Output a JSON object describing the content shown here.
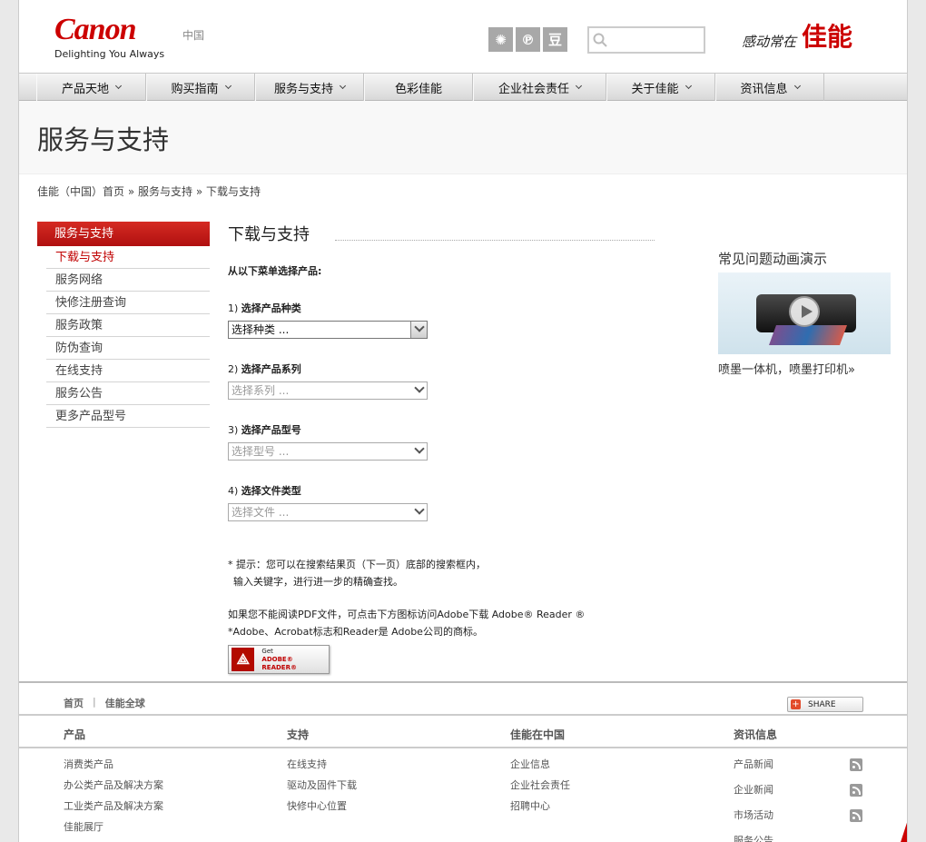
{
  "header": {
    "logo_text": "Canon",
    "tagline": "Delighting You Always",
    "region": "中国",
    "social": [
      {
        "icon": "weibo-icon",
        "glyph": "✺"
      },
      {
        "icon": "pinterest-icon",
        "glyph": "℗"
      },
      {
        "icon": "douban-icon",
        "glyph": "豆"
      }
    ],
    "search": {
      "value": "",
      "placeholder": ""
    },
    "slogan_small": "感动常在",
    "slogan_big": "佳能"
  },
  "nav": [
    {
      "label": "产品天地",
      "dropdown": true
    },
    {
      "label": "购买指南",
      "dropdown": true
    },
    {
      "label": "服务与支持",
      "dropdown": true
    },
    {
      "label": "色彩佳能",
      "dropdown": false
    },
    {
      "label": "企业社会责任",
      "dropdown": true
    },
    {
      "label": "关于佳能",
      "dropdown": true
    },
    {
      "label": "资讯信息",
      "dropdown": true
    }
  ],
  "page_title": "服务与支持",
  "breadcrumb": {
    "home": "佳能（中国）首页",
    "sep": "»",
    "level1": "服务与支持",
    "current": "下载与支持"
  },
  "sidebar": {
    "header": "服务与支持",
    "items": [
      "下载与支持",
      "服务网络",
      "快修注册查询",
      "服务政策",
      "防伪查询",
      "在线支持",
      "服务公告",
      "更多产品型号"
    ]
  },
  "main": {
    "title": "下载与支持",
    "instruction": "从以下菜单选择产品:",
    "steps": [
      {
        "num": "1)",
        "label": "选择产品种类",
        "value": "选择种类 ...",
        "enabled": true
      },
      {
        "num": "2)",
        "label": "选择产品系列",
        "value": "选择系列 ...",
        "enabled": false
      },
      {
        "num": "3)",
        "label": "选择产品型号",
        "value": "选择型号 ...",
        "enabled": false
      },
      {
        "num": "4)",
        "label": "选择文件类型",
        "value": "选择文件 ...",
        "enabled": false
      }
    ],
    "tip_line1": "* 提示：您可以在搜索结果页（下一页）底部的搜索框内，",
    "tip_line2": "输入关键字，进行进一步的精确查找。",
    "pdf_line1": "如果您不能阅读PDF文件，可点击下方图标访问Adobe下载 Adobe® Reader ®",
    "pdf_line2": "*Adobe、Acrobat标志和Reader是 Adobe公司的商标。",
    "adobe_get": "Get",
    "adobe_reader": "ADOBE® READER®"
  },
  "right": {
    "title": "常见问题动画演示",
    "link": "喷墨一体机，喷墨打印机»"
  },
  "footer": {
    "links": [
      "首页",
      "佳能全球"
    ],
    "link_sep": "|",
    "share": "SHARE",
    "columns": [
      {
        "head": "产品",
        "items": [
          "消费类产品",
          "办公类产品及解决方案",
          "工业类产品及解决方案",
          "佳能展厅"
        ]
      },
      {
        "head": "支持",
        "items": [
          "在线支持",
          "驱动及固件下载",
          "快修中心位置"
        ]
      },
      {
        "head": "佳能在中国",
        "items": [
          "企业信息",
          "企业社会责任",
          "招聘中心"
        ]
      },
      {
        "head": "资讯信息",
        "items": [
          "产品新闻",
          "企业新闻",
          "市场活动",
          "服务公告"
        ]
      }
    ]
  },
  "colors": {
    "brand": "#cc0000",
    "nav_bg": "#e0e0e0",
    "sidebar_active": "#c00000"
  }
}
